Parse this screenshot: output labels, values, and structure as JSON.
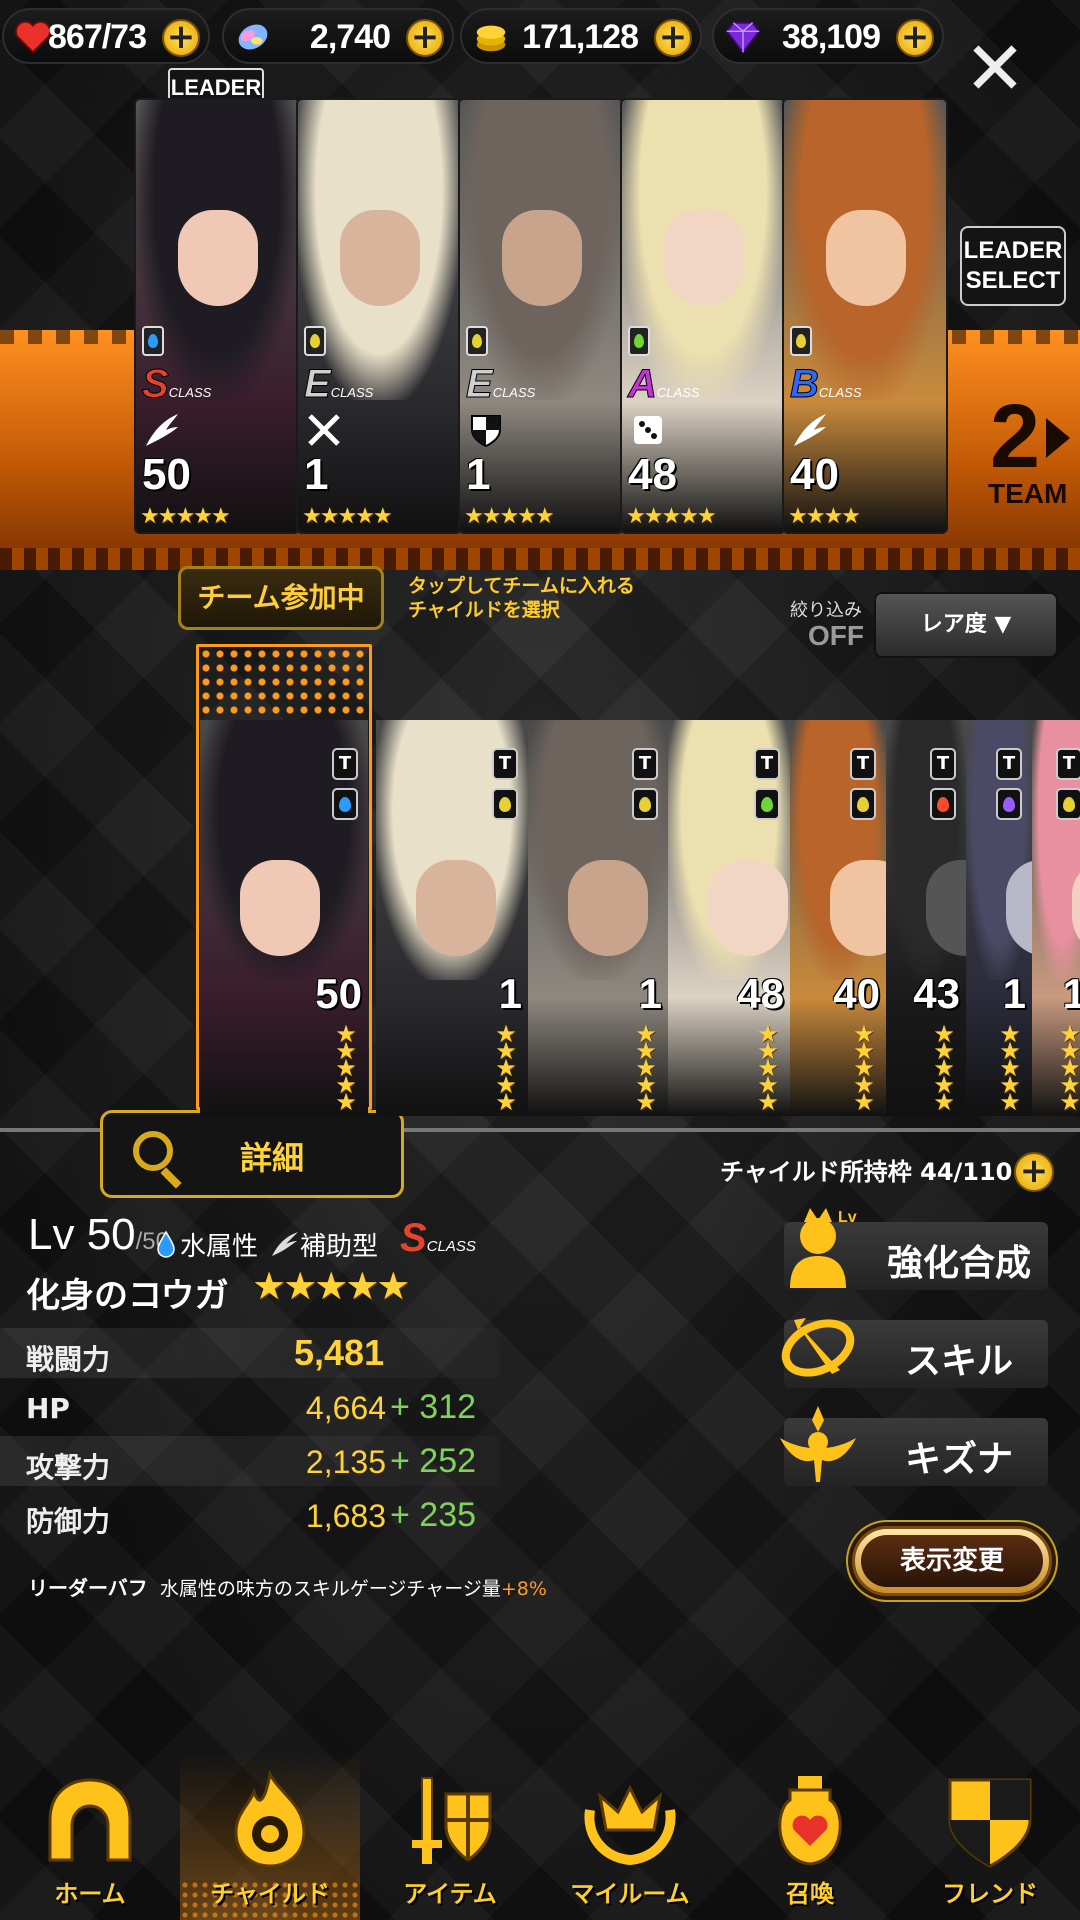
{
  "resources": {
    "stamina": "867/73",
    "crystal": "2,740",
    "gold": "171,128",
    "gem": "38,109"
  },
  "team": {
    "leader_badge": "LEADER",
    "leader_select": "LEADER SELECT",
    "team_number": "2",
    "team_word": "TEAM",
    "members": [
      {
        "class": "S",
        "class_color": "#e8432a",
        "element": "water",
        "element_color": "#2a9cff",
        "level": "50",
        "stars": "★★★★★",
        "type": "wing",
        "hair": "#1e1b22",
        "skin": "#f0c8b6",
        "outfit": "#3a1d2c"
      },
      {
        "class": "E",
        "class_color": "#cfcfcf",
        "element": "thunder",
        "element_color": "#e6d034",
        "level": "1",
        "stars": "★★★★★",
        "type": "swords",
        "hair": "#e8e0c8",
        "skin": "#d9b49c",
        "outfit": "#2a2a2e"
      },
      {
        "class": "E",
        "class_color": "#cfcfcf",
        "element": "thunder",
        "element_color": "#e6d034",
        "level": "1",
        "stars": "★★★★★",
        "type": "shield",
        "hair": "#6e645e",
        "skin": "#c9a48c",
        "outfit": "#8e8880"
      },
      {
        "class": "A",
        "class_color": "#c234d8",
        "element": "wind",
        "element_color": "#6fd63a",
        "level": "48",
        "stars": "★★★★★",
        "type": "dice",
        "hair": "#ece0b0",
        "skin": "#f2d6c4",
        "outfit": "#dcd2c4"
      },
      {
        "class": "B",
        "class_color": "#2a68ff",
        "element": "thunder",
        "element_color": "#e6d034",
        "level": "40",
        "stars": "★★★★",
        "type": "wing",
        "hair": "#b8642a",
        "skin": "#f0c4a0",
        "outfit": "#c98a3c"
      }
    ]
  },
  "controls": {
    "in_team_label": "チーム参加中",
    "hint_line1": "タップしてチームに入れる",
    "hint_line2": "チャイルドを選択",
    "filter_label": "絞り込み",
    "filter_state": "OFF",
    "sort_label": "レア度 ▼"
  },
  "roster": [
    {
      "level": "50",
      "element_color": "#2a9cff",
      "hair": "#1e1b22",
      "skin": "#f0c8b6",
      "outfit": "#3a1d2c"
    },
    {
      "level": "1",
      "element_color": "#e6d034",
      "hair": "#e8e0c8",
      "skin": "#d9b49c",
      "outfit": "#2a2a2e"
    },
    {
      "level": "1",
      "element_color": "#e6d034",
      "hair": "#6e645e",
      "skin": "#c9a48c",
      "outfit": "#8e8880"
    },
    {
      "level": "48",
      "element_color": "#6fd63a",
      "hair": "#ece0b0",
      "skin": "#f2d6c4",
      "outfit": "#dcd2c4"
    },
    {
      "level": "40",
      "element_color": "#e6d034",
      "hair": "#b8642a",
      "skin": "#f0c4a0",
      "outfit": "#c98a3c"
    },
    {
      "level": "43",
      "element_color": "#ff4a2a",
      "hair": "#2a2a2a",
      "skin": "#555",
      "outfit": "#1a1a1a"
    },
    {
      "level": "1",
      "element_color": "#9b5cff",
      "hair": "#4a4a66",
      "skin": "#b8b8c8",
      "outfit": "#2a2a3a"
    },
    {
      "level": "1",
      "element_color": "#e6d034",
      "hair": "#e890a0",
      "skin": "#f2d0c0",
      "outfit": "#c89a80"
    }
  ],
  "detail": {
    "detail_button": "詳細",
    "owned_slots": "チャイルド所持枠 44/110",
    "level": "Lv 50",
    "level_max": "/50",
    "attribute": "水属性",
    "type": "補助型",
    "class": "S",
    "class_suffix": "CLASS",
    "name": "化身のコウガ",
    "stars": "★★★★★",
    "stats": {
      "power_label": "戦闘力",
      "power_value": "5,481",
      "hp_label": "HP",
      "hp_base": "4,664",
      "hp_bonus": "+ 312",
      "atk_label": "攻撃力",
      "atk_base": "2,135",
      "atk_bonus": "+ 252",
      "def_label": "防御力",
      "def_base": "1,683",
      "def_bonus": "+ 235"
    },
    "leader_buff_label": "リーダーバフ",
    "leader_buff_text": "水属性の味方のスキルゲージチャージ量",
    "leader_buff_pct": "+8%",
    "actions": {
      "enhance": "強化合成",
      "skill": "スキル",
      "bond": "キズナ",
      "display_change": "表示変更"
    }
  },
  "nav": {
    "home": "ホーム",
    "child": "チャイルド",
    "item": "アイテム",
    "myroom": "マイルーム",
    "summon": "召喚",
    "friend": "フレンド"
  },
  "colors": {
    "accent_gold": "#ffd23a",
    "team_band_orange": "#e8740e",
    "bonus_green": "#7fd25a"
  }
}
